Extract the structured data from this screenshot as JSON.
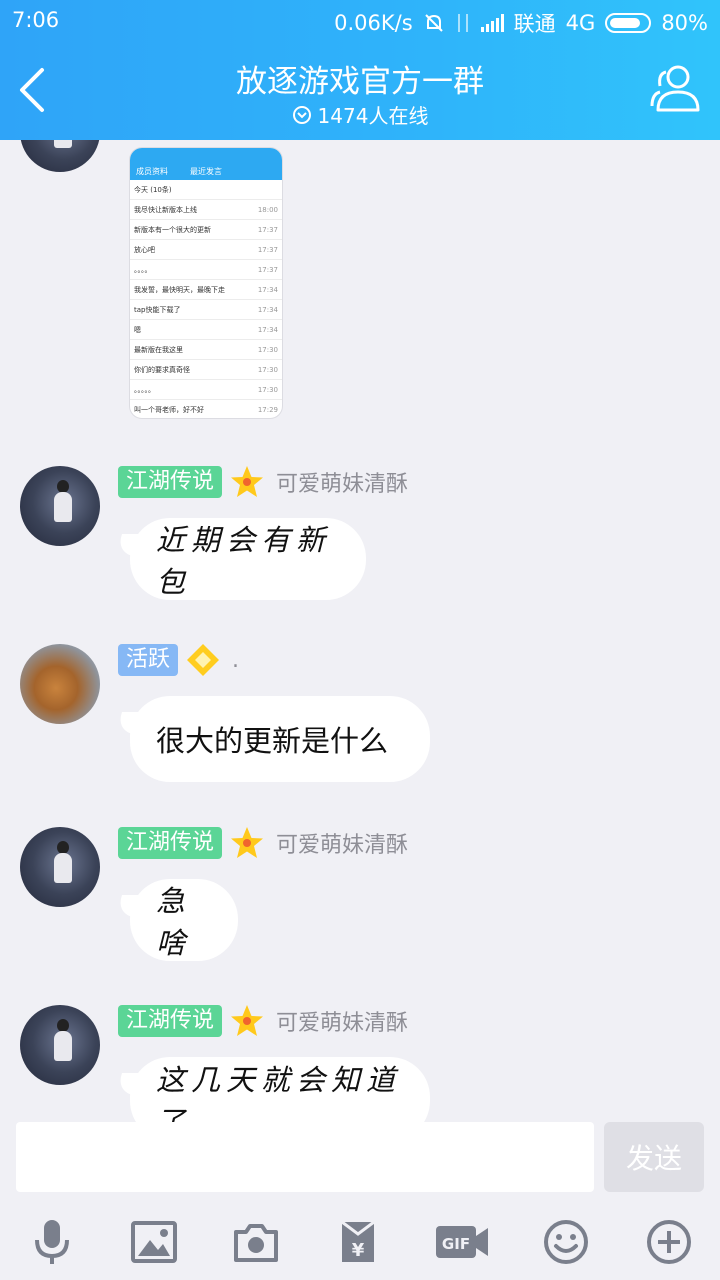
{
  "status_bar": {
    "time": "7:06",
    "speed": "0.06K/s",
    "carrier": "联通",
    "network": "4G",
    "battery": "80%"
  },
  "header": {
    "title": "放逐游戏官方一群",
    "online": "1474人在线"
  },
  "image_message": {
    "header_back": "成员资料",
    "header_title": "最近发言",
    "rows": [
      {
        "text": "今天 (10条)",
        "time": ""
      },
      {
        "text": "我尽快让新版本上线",
        "time": "18:00"
      },
      {
        "text": "新版本有一个很大的更新",
        "time": "17:37"
      },
      {
        "text": "放心吧",
        "time": "17:37"
      },
      {
        "text": "。。。。",
        "time": "17:37"
      },
      {
        "text": "我发誓，最快明天，最晚下走",
        "time": "17:34"
      },
      {
        "text": "tap快能下载了",
        "time": "17:34"
      },
      {
        "text": "嗯",
        "time": "17:34"
      },
      {
        "text": "最新版在我这里",
        "time": "17:30"
      },
      {
        "text": "你们的要求真奇怪",
        "time": "17:30"
      },
      {
        "text": "。。。。。",
        "time": "17:30"
      },
      {
        "text": "叫一个哥老师，好不好",
        "time": "17:29"
      }
    ]
  },
  "messages": [
    {
      "badge": "江湖传说",
      "nickname": "可爱萌妹清酥",
      "text": "近期会有新包"
    },
    {
      "badge": "活跃",
      "nickname": ".",
      "text": "很大的更新是什么"
    },
    {
      "badge": "江湖传说",
      "nickname": "可爱萌妹清酥",
      "text": "急啥"
    },
    {
      "badge": "江湖传说",
      "nickname": "可爱萌妹清酥",
      "text": "这几天就会知道了"
    }
  ],
  "input": {
    "placeholder": "",
    "send_label": "发送"
  },
  "toolbar": {
    "icons": [
      "microphone-icon",
      "image-icon",
      "camera-icon",
      "red-packet-icon",
      "gif-icon",
      "emoji-icon",
      "plus-icon"
    ]
  },
  "colors": {
    "header": "#2fb0f9",
    "badge_legend": "#5bd596",
    "badge_active": "#86b8f5",
    "background": "#f0f0f5"
  }
}
